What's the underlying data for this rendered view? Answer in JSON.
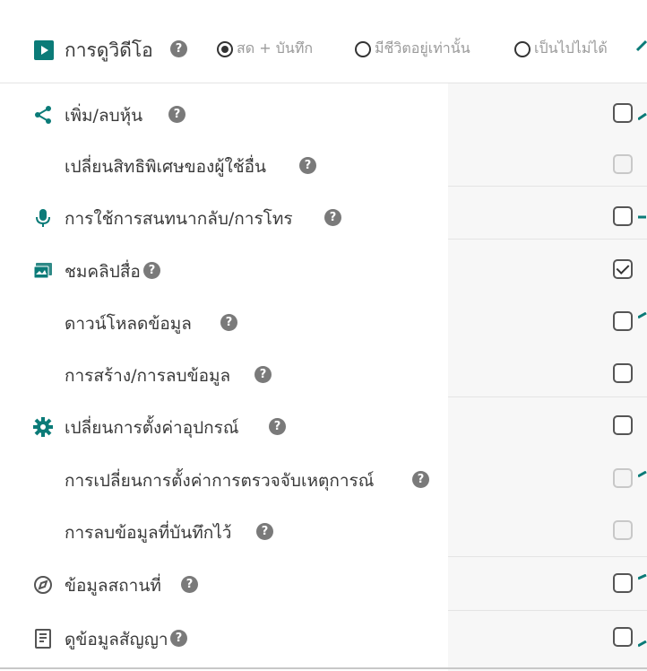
{
  "header": {
    "title": "การดูวิดีโอ",
    "help": "?",
    "options": [
      {
        "label": "สด + บันทึก",
        "checked": true
      },
      {
        "label": "มีชีวิตอยู่เท่านั้น",
        "checked": false
      },
      {
        "label": "เป็นไปไม่ได้",
        "checked": false
      }
    ]
  },
  "rows": [
    {
      "label": "เพิ่ม/ลบหุ้น",
      "icon": "share-icon",
      "checked": false,
      "disabled": false
    },
    {
      "label": "เปลี่ยนสิทธิพิเศษของผู้ใช้อื่น",
      "icon": "",
      "checked": false,
      "disabled": true
    },
    {
      "label": "การใช้การสนทนากลับ/การโทร",
      "icon": "microphone-icon",
      "checked": false,
      "disabled": false
    },
    {
      "label": "ชมคลิปสื่อ",
      "icon": "media-icon",
      "checked": true,
      "disabled": false
    },
    {
      "label": "ดาวน์โหลดข้อมูล",
      "icon": "",
      "checked": false,
      "disabled": false
    },
    {
      "label": "การสร้าง/การลบข้อมูล",
      "icon": "",
      "checked": false,
      "disabled": false
    },
    {
      "label": "เปลี่ยนการตั้งค่าอุปกรณ์",
      "icon": "gear-icon",
      "checked": false,
      "disabled": false
    },
    {
      "label": "การเปลี่ยนการตั้งค่าการตรวจจับเหตุการณ์",
      "icon": "",
      "checked": false,
      "disabled": true
    },
    {
      "label": "การลบข้อมูลที่บันทึกไว้",
      "icon": "",
      "checked": false,
      "disabled": true
    },
    {
      "label": "ข้อมูลสถานที่",
      "icon": "compass-icon",
      "checked": false,
      "disabled": false
    },
    {
      "label": "ดูข้อมูลสัญญา",
      "icon": "document-icon",
      "checked": false,
      "disabled": false
    }
  ],
  "colors": {
    "accent": "#0b7b78",
    "text": "#3a3a3a",
    "muted": "#9a9a9a"
  }
}
